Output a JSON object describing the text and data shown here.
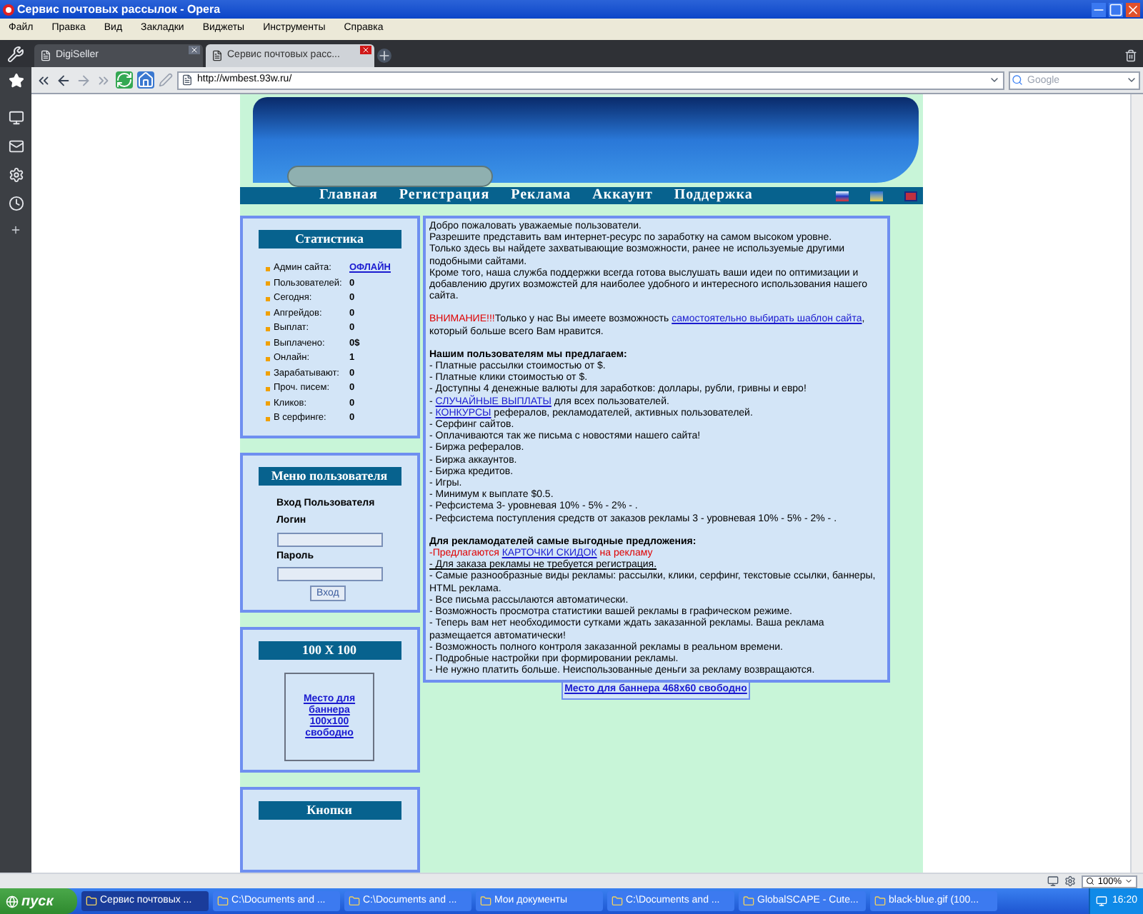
{
  "window": {
    "title": "Сервис почтовых рассылок - Opera"
  },
  "menu": [
    "Файл",
    "Правка",
    "Вид",
    "Закладки",
    "Виджеты",
    "Инструменты",
    "Справка"
  ],
  "tabs": [
    {
      "label": "DigiSeller",
      "selected": false
    },
    {
      "label": "Сервис почтовых расс...",
      "selected": true
    }
  ],
  "address": {
    "value": "http://wmbest.93w.ru/"
  },
  "search": {
    "placeholder": "Google"
  },
  "site": {
    "nav": [
      "Главная",
      "Регистрация",
      "Реклама",
      "Аккаунт",
      "Поддержка"
    ],
    "stats": {
      "title": "Статистика",
      "rows": [
        {
          "label": "Админ сайта:",
          "value": "ОФЛАЙН",
          "kind": "link"
        },
        {
          "label": "Пользователей:",
          "value": "0",
          "kind": "text"
        },
        {
          "label": "Сегодня:",
          "value": "0",
          "kind": "text"
        },
        {
          "label": "Апгрейдов:",
          "value": "0",
          "kind": "text"
        },
        {
          "label": "Выплат:",
          "value": "0",
          "kind": "text"
        },
        {
          "label": "Выплачено:",
          "value": "0$",
          "kind": "text"
        },
        {
          "label": "Онлайн:",
          "value": "1",
          "kind": "text"
        },
        {
          "label": "Зарабатывают:",
          "value": "0",
          "kind": "text"
        },
        {
          "label": "Проч. писем:",
          "value": "0",
          "kind": "text"
        },
        {
          "label": "Кликов:",
          "value": "0",
          "kind": "text"
        },
        {
          "label": "В серфинге:",
          "value": "0",
          "kind": "text"
        }
      ]
    },
    "user_menu": {
      "title": "Меню пользователя",
      "heading": "Вход Пользователя",
      "login_label": "Логин",
      "password_label": "Пароль",
      "button": "Вход"
    },
    "banner_box": {
      "title": "100 X 100",
      "link": "Место для баннера 100x100 свободно"
    },
    "buttons_box": {
      "title": "Кнопки"
    },
    "content": [
      {
        "kind": "line",
        "segments": [
          {
            "kind": "plain",
            "text": "Добро пожаловать уважаемые пользователи."
          }
        ]
      },
      {
        "kind": "line",
        "segments": [
          {
            "kind": "plain",
            "text": "Разрешите представить вам интернет-ресурс по заработку на самом высоком уровне."
          }
        ]
      },
      {
        "kind": "line",
        "segments": [
          {
            "kind": "plain",
            "text": "Только здесь вы найдете захватывающие возможности, ранее не используемые другими подобными сайтами."
          }
        ]
      },
      {
        "kind": "line",
        "segments": [
          {
            "kind": "plain",
            "text": "Кроме того, наша служба поддержки всегда готова выслушать ваши идеи по оптимизации и добавлению других возможстей для наиболее удобного и интересного использования нашего сайта."
          }
        ]
      },
      {
        "kind": "gap"
      },
      {
        "kind": "line",
        "segments": [
          {
            "kind": "alert",
            "text": "ВНИМАНИЕ!!!"
          },
          {
            "kind": "plain",
            "text": "Только у нас Вы имеете возможность "
          },
          {
            "kind": "link",
            "text": "самостоятельно выбирать шаблон сайта"
          },
          {
            "kind": "plain",
            "text": ", который больше всего Вам нравится."
          }
        ]
      },
      {
        "kind": "gap"
      },
      {
        "kind": "heading",
        "segments": [
          {
            "kind": "plain",
            "text": "Нашим пользователям мы предлагаем:"
          }
        ]
      },
      {
        "kind": "line",
        "segments": [
          {
            "kind": "plain",
            "text": "- Платные рассылки стоимостью от $."
          }
        ]
      },
      {
        "kind": "line",
        "segments": [
          {
            "kind": "plain",
            "text": "- Платные клики стоимостью от $."
          }
        ]
      },
      {
        "kind": "line",
        "segments": [
          {
            "kind": "plain",
            "text": "- Доступны 4 денежные валюты для заработков: доллары, рубли, гривны и евро!"
          }
        ]
      },
      {
        "kind": "line",
        "segments": [
          {
            "kind": "plain",
            "text": "- "
          },
          {
            "kind": "link",
            "text": "СЛУЧАЙНЫЕ ВЫПЛАТЫ"
          },
          {
            "kind": "plain",
            "text": " для всех пользователей."
          }
        ]
      },
      {
        "kind": "line",
        "segments": [
          {
            "kind": "plain",
            "text": "- "
          },
          {
            "kind": "link",
            "text": "КОНКУРСЫ"
          },
          {
            "kind": "plain",
            "text": " рефералов, рекламодателей, активных пользователей."
          }
        ]
      },
      {
        "kind": "line",
        "segments": [
          {
            "kind": "plain",
            "text": "- Серфинг сайтов."
          }
        ]
      },
      {
        "kind": "line",
        "segments": [
          {
            "kind": "plain",
            "text": "- Оплачиваются так же письма с новостями нашего сайта!"
          }
        ]
      },
      {
        "kind": "line",
        "segments": [
          {
            "kind": "plain",
            "text": "- Биржа рефералов."
          }
        ]
      },
      {
        "kind": "line",
        "segments": [
          {
            "kind": "plain",
            "text": "- Биржа аккаунтов."
          }
        ]
      },
      {
        "kind": "line",
        "segments": [
          {
            "kind": "plain",
            "text": "- Биржа кредитов."
          }
        ]
      },
      {
        "kind": "line",
        "segments": [
          {
            "kind": "plain",
            "text": "- Игры."
          }
        ]
      },
      {
        "kind": "line",
        "segments": [
          {
            "kind": "plain",
            "text": "- Минимум к выплате $0.5."
          }
        ]
      },
      {
        "kind": "line",
        "segments": [
          {
            "kind": "plain",
            "text": "- Рефсистема 3- уровневая 10% - 5% - 2% - ."
          }
        ]
      },
      {
        "kind": "line",
        "segments": [
          {
            "kind": "plain",
            "text": "- Рефсистема поступления средств от заказов рекламы 3 - уровневая 10% - 5% - 2% - ."
          }
        ]
      },
      {
        "kind": "gap"
      },
      {
        "kind": "heading",
        "segments": [
          {
            "kind": "plain",
            "text": "Для рекламодателей самые выгодные предложения:"
          }
        ]
      },
      {
        "kind": "line",
        "segments": [
          {
            "kind": "alert",
            "text": "-Предлагаются "
          },
          {
            "kind": "link",
            "text": "КАРТОЧКИ СКИДОК"
          },
          {
            "kind": "alert",
            "text": " на рекламу"
          }
        ]
      },
      {
        "kind": "line",
        "segments": [
          {
            "kind": "underline",
            "text": "- Для заказа рекламы не требуется регистрация."
          }
        ]
      },
      {
        "kind": "line",
        "segments": [
          {
            "kind": "plain",
            "text": "- Самые разнообразные виды рекламы: рассылки, клики, серфинг, текстовые ссылки, баннеры, HTML реклама."
          }
        ]
      },
      {
        "kind": "line",
        "segments": [
          {
            "kind": "plain",
            "text": "- Все письма рассылаются автоматически."
          }
        ]
      },
      {
        "kind": "line",
        "segments": [
          {
            "kind": "plain",
            "text": "- Возможность просмотра статистики вашей рекламы в графическом режиме."
          }
        ]
      },
      {
        "kind": "line",
        "segments": [
          {
            "kind": "plain",
            "text": "- Теперь вам нет необходимости сутками ждать заказанной рекламы. Ваша реклама размещается автоматически!"
          }
        ]
      },
      {
        "kind": "line",
        "segments": [
          {
            "kind": "plain",
            "text": "- Возможность полного контроля заказанной рекламы в реальном времени."
          }
        ]
      },
      {
        "kind": "line",
        "segments": [
          {
            "kind": "plain",
            "text": "- Подробные настройки при формировании рекламы."
          }
        ]
      },
      {
        "kind": "line",
        "segments": [
          {
            "kind": "plain",
            "text": "- Не нужно платить больше. Неиспользованные деньги за рекламу возвращаются."
          }
        ]
      }
    ],
    "banner_link": "Место для баннера 468x60 свободно"
  },
  "status_bar": {
    "zoom": "100%"
  },
  "taskbar": {
    "start": "пуск",
    "tasks": [
      {
        "label": "Сервис почтовых ...",
        "selected": true
      },
      {
        "label": "C:\\Documents and ...",
        "selected": false
      },
      {
        "label": "C:\\Documents and ...",
        "selected": false
      },
      {
        "label": "Мои документы",
        "selected": false
      },
      {
        "label": "C:\\Documents and ...",
        "selected": false
      },
      {
        "label": "GlobalSCAPE - Cute...",
        "selected": false
      },
      {
        "label": "black-blue.gif (100...",
        "selected": false
      }
    ],
    "clock": "16:20"
  }
}
